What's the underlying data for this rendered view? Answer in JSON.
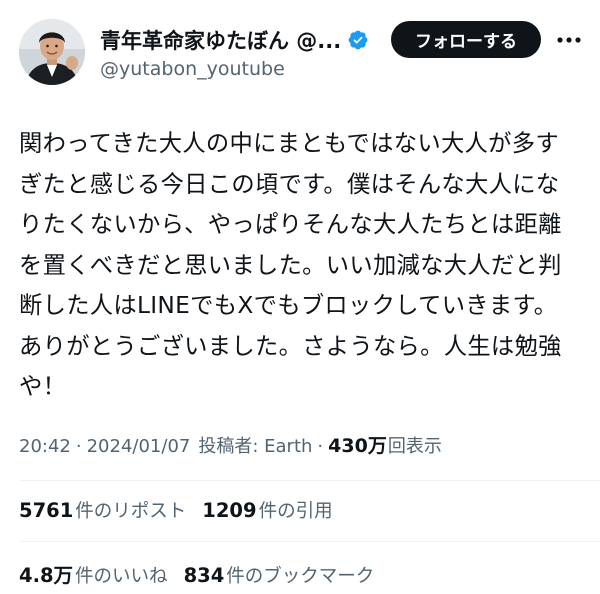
{
  "header": {
    "display_name": "青年革命家ゆたぼん @...",
    "handle": "@yutabon_youtube",
    "follow_label": "フォローする",
    "more_icon": "more-horizontal-icon",
    "verified_icon": "verified-badge-icon",
    "verified_color": "#1d9bf0"
  },
  "tweet": {
    "lines": [
      "関わってきた大人の中にまともではない大人が多す",
      "ぎたと感じる今日この頃です。僕はそんな大人にな",
      "りたくないから、やっぱりそんな大人たちとは距離",
      "を置くべきだと思いました。いい加減な大人だと判",
      "断した人はLINEでもXでもブロックしていきます。",
      "ありがとうございました。さようなら。人生は勉強",
      "や！"
    ]
  },
  "meta": {
    "time": "20:42",
    "sep1": "·",
    "date": "2024/01/07",
    "poster": "投稿者: Earth",
    "sep2": "·",
    "views_num": "430万",
    "views_label": "回表示"
  },
  "stats": {
    "reposts_num": "5761",
    "reposts_label": "件のリポスト",
    "quotes_num": "1209",
    "quotes_label": "件の引用",
    "likes_num": "4.8万",
    "likes_label": "件のいいね",
    "bookmarks_num": "834",
    "bookmarks_label": "件のブックマーク"
  }
}
